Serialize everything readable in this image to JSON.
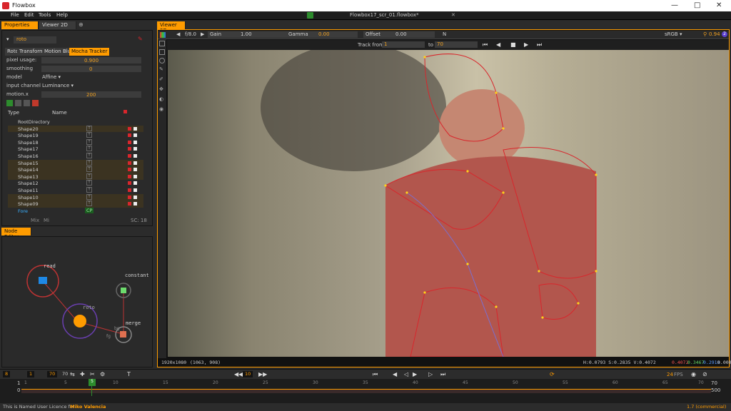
{
  "window": {
    "title": "Flowbox",
    "project_file": "Flowbox17_scr_01.flowbox*"
  },
  "menu": [
    "File",
    "Edit",
    "Tools",
    "Help"
  ],
  "left_tabs": [
    "Properties",
    "Viewer 2D"
  ],
  "properties": {
    "node_name": "roto",
    "subtabs": [
      "Roto",
      "Transform",
      "Motion Blur",
      "Mocha Tracker"
    ],
    "fields": [
      {
        "label": "pixel usage:",
        "value": "0.900"
      },
      {
        "label": "smoothing",
        "value": "0"
      },
      {
        "label": "model",
        "value": "Affine"
      },
      {
        "label": "input channel",
        "value": "Luminance"
      },
      {
        "label": "motion.x",
        "value": "200"
      }
    ],
    "layer_headers": {
      "type": "Type",
      "name": "Name"
    },
    "layers": [
      "RootDirectory",
      "Shape20",
      "Shape19",
      "Shape18",
      "Shape17",
      "Shape16",
      "Shape15",
      "Shape14",
      "Shape13",
      "Shape12",
      "Shape11",
      "Shape10",
      "Shape09",
      "Fore"
    ],
    "fore_badge": "CP",
    "footer_left": "Mix",
    "footer_mid": "Mi",
    "footer_right": "SC: 18"
  },
  "node_editor": {
    "title": "Node Editor",
    "nodes": [
      {
        "label": "read"
      },
      {
        "label": "constant"
      },
      {
        "label": "roto"
      },
      {
        "label": "merge"
      }
    ],
    "merge_ports": [
      "bg",
      "fg"
    ]
  },
  "viewer": {
    "tab": "Viewer 2D",
    "fstop": "f/8.0",
    "gain_label": "Gain",
    "gain_value": "1.00",
    "gamma_label": "Gamma",
    "gamma_value": "0.00",
    "offset_label": "Offset",
    "offset_value": "0.00",
    "channel": "N",
    "colorspace": "sRGB",
    "zoom": "0.94",
    "zoom_badge": "2",
    "track_from_label": "Track from",
    "track_from": "1",
    "track_to_label": "to",
    "track_to": "70",
    "resolution": "1920x1080",
    "coords": "(1063, 908)",
    "hsv": "H:0.0793 S:0.2835 V:0.4072",
    "rgba": {
      "r": "0.4072",
      "g": "0.3467",
      "b": "0.2918",
      "a": "0.0000"
    }
  },
  "timeline": {
    "start": "8",
    "in": "1",
    "out": "70",
    "out2": "70",
    "step": "10",
    "fps": "24",
    "fps_label": "FPS",
    "range_left": "1",
    "range_left2": "0",
    "range_right": "70",
    "range_right2": "500",
    "ticks": [
      "1",
      "5",
      "10",
      "15",
      "20",
      "25",
      "30",
      "35",
      "40",
      "45",
      "50",
      "55",
      "60",
      "65",
      "70"
    ],
    "current_frame": "5"
  },
  "status": {
    "licence_prefix": "This is Named User Licence for",
    "licence_user": "Miko Valencia",
    "version": "1.7 (commercial)"
  },
  "colors": {
    "accent": "#ff9c00",
    "roto_line": "#d8262c"
  }
}
